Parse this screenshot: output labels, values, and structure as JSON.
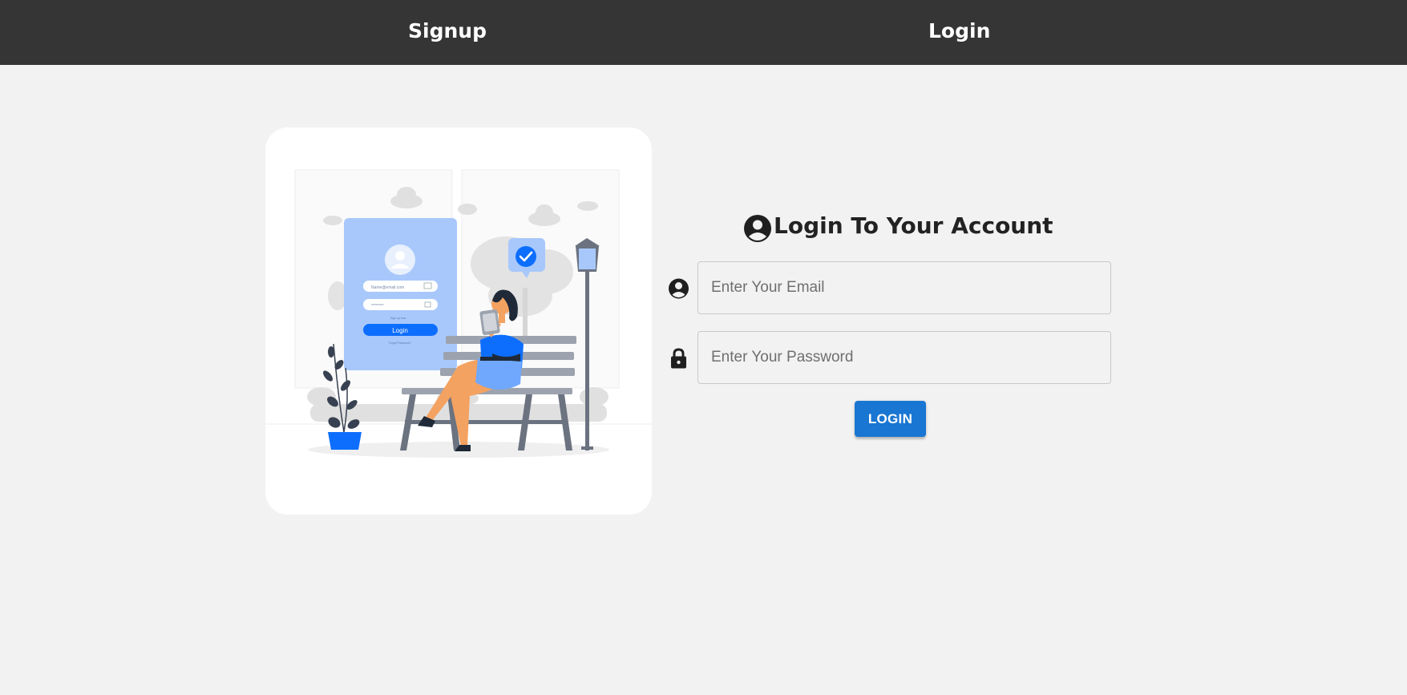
{
  "nav": {
    "signup_label": "Signup",
    "login_label": "Login"
  },
  "form": {
    "title": "Login To Your Account",
    "email_placeholder": "Enter Your Email",
    "password_placeholder": "Enter Your Password",
    "submit_label": "LOGIN"
  },
  "illustration": {
    "email_text": "Name@email.com",
    "password_text": "********",
    "sign_up_text": "Sign up now",
    "button_text": "Login",
    "forgot_text": "Forgot Password?"
  },
  "icons": {
    "title": "account-circle-icon",
    "email": "account-circle-icon",
    "password": "lock-icon"
  },
  "colors": {
    "navbar": "#353535",
    "background": "#f2f2f2",
    "accent": "#1976d2",
    "illustration_blue": "#0d6efd",
    "illustration_light_blue": "#a8c8fb"
  }
}
